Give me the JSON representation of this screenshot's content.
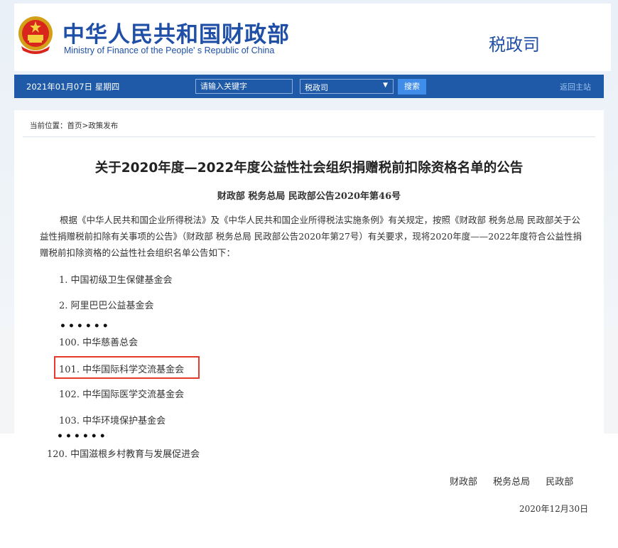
{
  "header": {
    "ministry_cn": "中华人民共和国财政部",
    "ministry_en": "Ministry of Finance of the People' s Republic of China",
    "department": "税政司",
    "brand_color": "#1f4fa6"
  },
  "toolbar": {
    "date": "2021年01月07日  星期四",
    "search_placeholder": "请输入关键字",
    "dept_select_value": "税政司",
    "search_button": "搜索",
    "home_link": "返回主站",
    "bar_color": "#1e5aa7"
  },
  "breadcrumb": {
    "prefix": "当前位置：",
    "home": "首页",
    "separator": ">",
    "current": "政策发布"
  },
  "document": {
    "title": "关于2020年度—2022年度公益性社会组织捐赠税前扣除资格名单的公告",
    "number": "财政部  税务总局  民政部公告2020年第46号",
    "paragraph": "根据《中华人民共和国企业所得税法》及《中华人民共和国企业所得税法实施条例》有关规定，按照《财政部 税务总局 民政部关于公益性捐赠税前扣除有关事项的公告》（财政部 税务总局 民政部公告2020年第27号）有关要求，现将2020年度——2022年度符合公益性捐赠税前扣除资格的公益性社会组织名单公告如下：",
    "items": [
      "1. 中国初级卫生保健基金会",
      "2. 阿里巴巴公益基金会",
      "100. 中华慈善总会",
      "101. 中华国际科学交流基金会",
      "102. 中华国际医学交流基金会",
      "103. 中华环境保护基金会",
      "120. 中国滋根乡村教育与发展促进会"
    ],
    "ellipsis": "••••••",
    "highlighted_item_index": 3,
    "highlight_color": "#e33a2c",
    "signers": "财政部 税务总局 民政部",
    "date": "2020年12月30日"
  }
}
